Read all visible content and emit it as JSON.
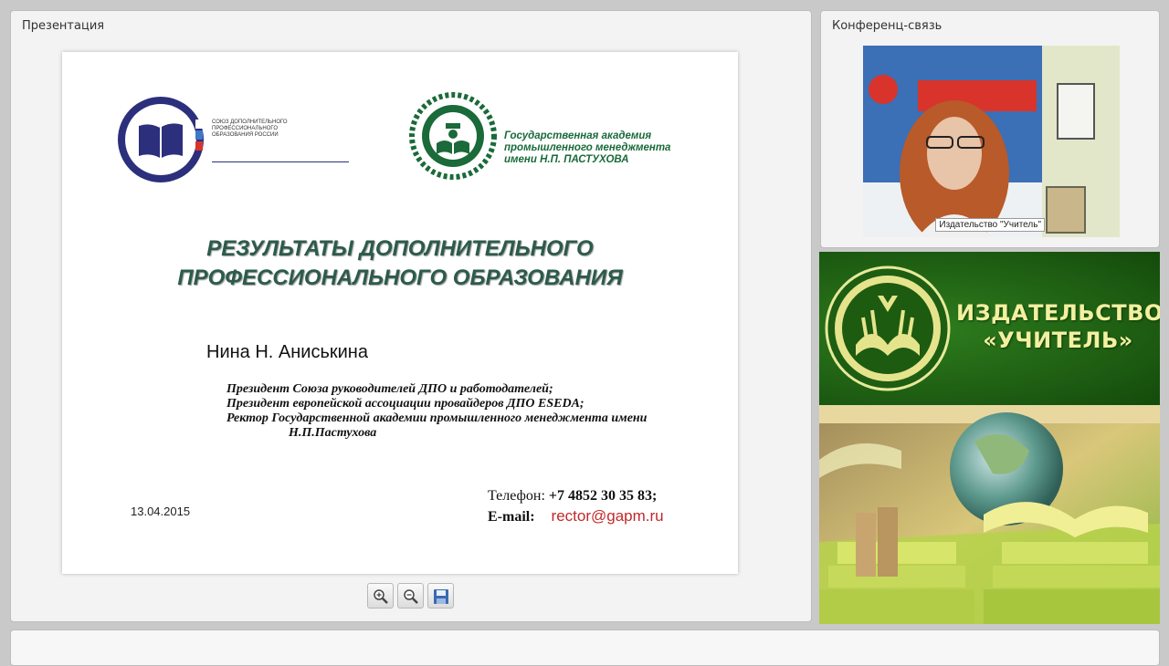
{
  "presentation_panel": {
    "title": "Презентация"
  },
  "conference_panel": {
    "title": "Конференц-связь",
    "participant_label": "Издательство \"Учитель\""
  },
  "slide": {
    "left_logo_text": "Союз дополнительного профессионального образования России",
    "right_logo_text": "Государственная академия промышленного менеджмента имени Н.П. ПАСТУХОВА",
    "title_line1": "РЕЗУЛЬТАТЫ ДОПОЛНИТЕЛЬНОГО",
    "title_line2": "ПРОФЕССИОНАЛЬНОГО ОБРАЗОВАНИЯ",
    "author": "Нина Н. Аниськина",
    "positions": [
      "Президент Союза руководителей ДПО и работодателей;",
      "Президент европейской ассоциации провайдеров ДПО ESEDA;",
      "Ректор Государственной академии промышленного менеджмента имени Н.П.Пастухова"
    ],
    "date": "13.04.2015",
    "phone_label": "Телефон:",
    "phone_value": "+7 4852 30 35 83;",
    "email_label": "E-mail:",
    "email_value": "rector@gapm.ru"
  },
  "toolbar": {
    "zoom_in_icon": "zoom-in-icon",
    "zoom_out_icon": "zoom-out-icon",
    "save_icon": "save-icon"
  },
  "banner": {
    "line1": "ИЗДАТЕЛЬСТВО",
    "line2": "«УЧИТЕЛЬ»",
    "video_poster_text": "Учитель"
  },
  "colors": {
    "slide_title": "#2c5b4a",
    "banner_green": "#1c5a11",
    "banner_text": "#f3f0a0",
    "email": "#c0292a"
  }
}
